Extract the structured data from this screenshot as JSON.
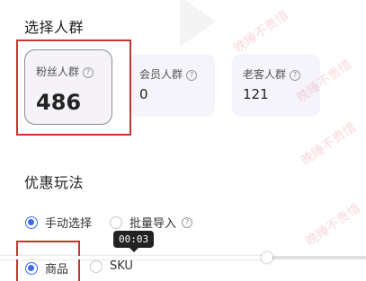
{
  "audience": {
    "title": "选择人群",
    "cards": [
      {
        "label": "粉丝人群",
        "value": "486",
        "has_help": true,
        "selected": true
      },
      {
        "label": "会员人群",
        "value": "0",
        "has_help": true,
        "selected": false
      },
      {
        "label": "老客人群",
        "value": "121",
        "has_help": true,
        "selected": false
      }
    ]
  },
  "offer": {
    "title": "优惠玩法",
    "mode_options": [
      {
        "label": "手动选择",
        "checked": true
      },
      {
        "label": "批量导入",
        "checked": false
      }
    ],
    "type_options": [
      {
        "label": "商品",
        "checked": true
      },
      {
        "label": "SKU",
        "checked": false
      }
    ]
  },
  "player": {
    "time_tooltip": "00:03",
    "progress_fraction": 0.73
  },
  "watermark_text": "晚睡不贵惜",
  "colors": {
    "accent": "#3b6cf5",
    "highlight_box": "#c8342f"
  },
  "icons": {
    "help": "question-circle-icon"
  }
}
